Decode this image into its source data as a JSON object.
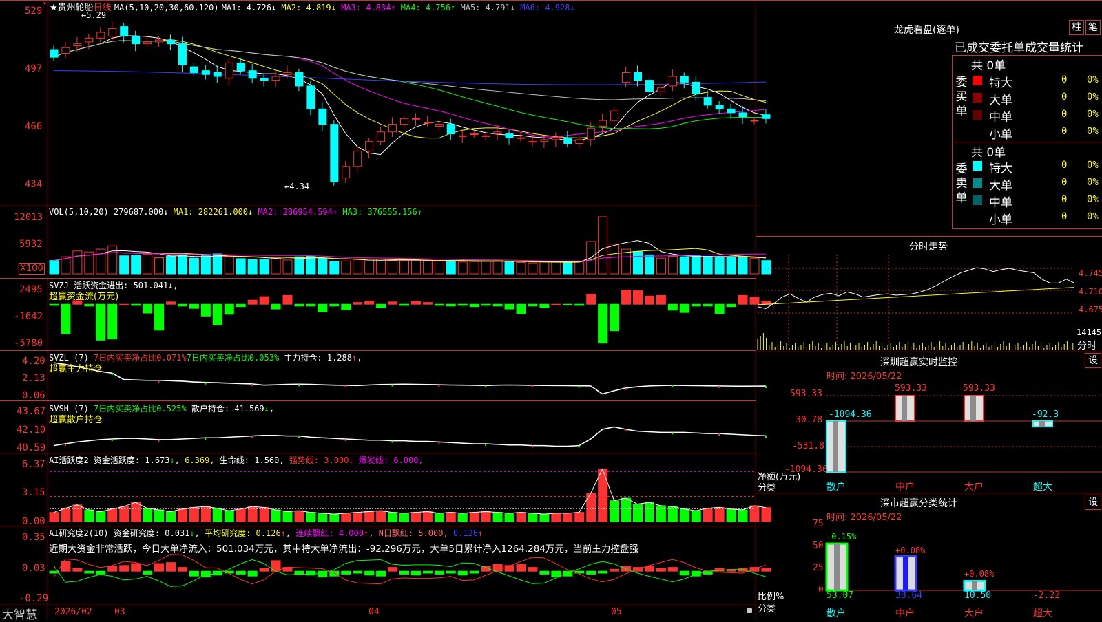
{
  "header": {
    "star": "★",
    "stock_name": "贵州轮胎",
    "period": "日线",
    "ma_params": "MA(5,10,20,30,60,120)",
    "mas": [
      {
        "label": "MA1:",
        "value": "4.726",
        "arrow": "↓",
        "color": "#ffffff"
      },
      {
        "label": "MA2:",
        "value": "4.819",
        "arrow": "↓",
        "color": "#ffff00"
      },
      {
        "label": "MA3:",
        "value": "4.834",
        "arrow": "↑",
        "color": "#ff00ff"
      },
      {
        "label": "MA4:",
        "value": "4.756",
        "arrow": "↑",
        "color": "#00ff00"
      },
      {
        "label": "MA5:",
        "value": "4.791",
        "arrow": "↓",
        "color": "#c0c0c0"
      },
      {
        "label": "MA6:",
        "value": "4.928",
        "arrow": "↓",
        "color": "#3c3cff"
      }
    ],
    "price_ticks": [
      "529",
      "497",
      "466",
      "434"
    ],
    "high_label": "5.29",
    "low_label": "4.34"
  },
  "vol": {
    "header": "VOL(5,10,20)",
    "value": "279687.000",
    "value_arrow": "↓",
    "ma1": "MA1: 282261.000",
    "ma1_arrow": "↓",
    "ma2": "MA2: 286954.594",
    "ma2_arrow": "↑",
    "ma3": "MA3: 376555.156",
    "ma3_arrow": "↑",
    "ticks": [
      "12013",
      "5932"
    ],
    "unit": "X100"
  },
  "svzj": {
    "header": "SVZJ  活跃资金进出: 501.041",
    "header_arrow": "↓",
    "sub": "超赢资金流(万元)",
    "ticks": [
      "2495",
      "-1642",
      "-5780"
    ]
  },
  "svzl": {
    "header": "SVZL (7)",
    "t1": "7日内买卖净占比0.071%",
    "t2": "7日内买卖净占比0.053%",
    "t3": "主力持仓: 1.288",
    "t3_arrow": "↑",
    "sub": "超赢主力持仓",
    "ticks": [
      "4.20",
      "2.13",
      "0.06"
    ]
  },
  "svsh": {
    "header": "SVSH (7)",
    "t1": "7日内买卖净占比0.525%",
    "t2": "散户持仓: 41.569",
    "t2_arrow": "↓",
    "sub": "超赢散户持仓",
    "ticks": [
      "43.67",
      "42.10",
      "40.59"
    ]
  },
  "ai1": {
    "header": "AI活跃度2",
    "t1": "资金活跃度: 1.673",
    "t1_arrow": "↓",
    "t2": "6.369",
    "t3": "生命线: 1.560,",
    "t4": "强势线: 3.000,",
    "t5": "爆发线: 6.000,",
    "ticks": [
      "6.37",
      "3.15",
      "0.00"
    ]
  },
  "ai2": {
    "header": "AI研究度2(10)",
    "t1": "资金研究度: 0.031",
    "t1_arrow": "↓",
    "t2": "平均研究度: 0.126",
    "t2_arrow": "↑",
    "t3": "连续飘红: 4.000",
    "t3_arrow": "↑",
    "t4": "N日飘红: 5.000,",
    "t5": "0.126",
    "t5_arrow": "↑",
    "comment": "近期大资金非常活跃，今日大单净流入：501.034万元，其中特大单净流出：-92.296万元，大单5日累计净入1264.284万元，当前主力控盘强",
    "ticks": [
      "0.35",
      "0.03",
      "-0.29"
    ]
  },
  "footer": {
    "brand": "大智慧",
    "dates": [
      "2026/02",
      "03",
      "04",
      "05"
    ]
  },
  "right": {
    "lh_title": "龙虎看盘(逐单)",
    "btn_zhu": "柱",
    "btn_bi": "笔",
    "lh_sub": "已成交委托单成交量统计",
    "buy_label": "委买单",
    "sell_label": "委卖单",
    "buy_total": "共 0单",
    "sell_total": "共 0单",
    "buy_rows": [
      {
        "name": "特大",
        "n": "0",
        "pct": "0%",
        "color": "#ff0000"
      },
      {
        "name": "大单",
        "n": "0",
        "pct": "0%",
        "color": "#8c0000"
      },
      {
        "name": "中单",
        "n": "0",
        "pct": "0%",
        "color": "#640000"
      },
      {
        "name": "小单",
        "n": "0",
        "pct": "0%",
        "color": "#000000"
      }
    ],
    "sell_rows": [
      {
        "name": "特大",
        "n": "0",
        "pct": "0%",
        "color": "#00ffff"
      },
      {
        "name": "大单",
        "n": "0",
        "pct": "0%",
        "color": "#008c8c"
      },
      {
        "name": "中单",
        "n": "0",
        "pct": "0%",
        "color": "#006464"
      },
      {
        "name": "小单",
        "n": "0",
        "pct": "0%",
        "color": "#000000"
      }
    ],
    "fs_title": "分时走势",
    "fs_ticks": [
      "4.745",
      "4.710",
      "4.675"
    ],
    "fs_vol": "14145",
    "fs_unit": "分时",
    "sz_title": "深圳超赢实时监控",
    "sz_btn": "设",
    "sz_time": "时间: 2026/05/22",
    "sz_ticks": [
      "593.33",
      "30.78",
      "-531.8",
      "-1094.36"
    ],
    "sz_ylabel": "净额(万元)",
    "sz_xlabel": "分类",
    "sz_bar_labels": [
      "-1094.36",
      "593.33",
      "593.33",
      "-92.3"
    ],
    "cat": [
      "散户",
      "中户",
      "大户",
      "超大"
    ],
    "ss_title": "深市超赢分类统计",
    "ss_btn": "设",
    "ss_time": "时间: 2026/05/22",
    "ss_ticks": [
      "75",
      "50",
      "25",
      "0"
    ],
    "ss_ylabel": "比例%",
    "ss_xlabel": "分类",
    "ss_bar_labels": [
      "-0.15%",
      "+0.08%",
      "+0.08%"
    ],
    "ss_values": [
      "53.07",
      "38.64",
      "10.50",
      "-2.22"
    ]
  },
  "chart_data": [
    {
      "type": "candlestick",
      "title": "贵州轮胎 日线",
      "y_range": [
        4.34,
        5.29
      ],
      "close": [
        5.05,
        5.1,
        5.12,
        5.15,
        5.18,
        5.2,
        5.16,
        5.12,
        5.13,
        5.14,
        5.12,
        5.01,
        4.97,
        4.96,
        4.95,
        5.02,
        4.98,
        4.94,
        4.93,
        4.95,
        4.97,
        4.9,
        4.78,
        4.7,
        4.4,
        4.48,
        4.56,
        4.61,
        4.66,
        4.7,
        4.73,
        4.73,
        4.71,
        4.7,
        4.65,
        4.64,
        4.65,
        4.64,
        4.66,
        4.63,
        4.63,
        4.61,
        4.62,
        4.63,
        4.6,
        4.62,
        4.68,
        4.72,
        4.77,
        4.97,
        4.93,
        4.87,
        4.89,
        4.95,
        4.92,
        4.86,
        4.8,
        4.78,
        4.76,
        4.74,
        4.72,
        4.73
      ],
      "open": [
        5.09,
        5.07,
        5.11,
        5.13,
        5.15,
        5.16,
        5.21,
        5.16,
        5.12,
        5.13,
        5.14,
        5.12,
        5.0,
        4.98,
        4.97,
        4.94,
        5.02,
        4.98,
        4.94,
        4.93,
        4.96,
        4.97,
        4.9,
        4.78,
        4.7,
        4.42,
        4.48,
        4.56,
        4.61,
        4.66,
        4.7,
        4.73,
        4.71,
        4.69,
        4.7,
        4.64,
        4.65,
        4.64,
        4.65,
        4.65,
        4.63,
        4.61,
        4.61,
        4.62,
        4.63,
        4.6,
        4.62,
        4.69,
        4.72,
        4.92,
        4.97,
        4.93,
        4.87,
        4.9,
        4.95,
        4.92,
        4.84,
        4.8,
        4.78,
        4.76,
        4.72,
        4.75
      ]
    },
    {
      "type": "bar",
      "title": "VOL(5,10,20)",
      "values": [
        2800,
        3600,
        4800,
        4600,
        5200,
        5900,
        3800,
        3900,
        4100,
        3400,
        3700,
        3900,
        3300,
        3800,
        4200,
        3600,
        3200,
        3000,
        3100,
        3400,
        2900,
        3600,
        3700,
        3300,
        2600,
        2700,
        3000,
        2900,
        3100,
        2800,
        2700,
        2900,
        2800,
        2700,
        2600,
        2500,
        2600,
        2700,
        2800,
        2500,
        2400,
        2300,
        2500,
        2600,
        2400,
        2500,
        6800,
        12013,
        6300,
        5200,
        4700,
        4000,
        3300,
        3700,
        3600,
        3800,
        3700,
        3500,
        3600,
        3400,
        3300,
        2796
      ]
    },
    {
      "type": "bar",
      "title": "超赢资金流(万元)",
      "values": [
        -200,
        -5000,
        600,
        -300,
        -6100,
        -5900,
        0,
        -200,
        -1500,
        -4400,
        400,
        -300,
        -700,
        -2000,
        -3500,
        -1700,
        -400,
        700,
        1300,
        -800,
        1500,
        -300,
        -300,
        -1300,
        -300,
        -900,
        300,
        500,
        -600,
        400,
        -200,
        500,
        300,
        -200,
        -300,
        -200,
        -400,
        -200,
        -300,
        -800,
        -1600,
        -300,
        -600,
        0,
        -100,
        -200,
        1700,
        -6600,
        -4500,
        2400,
        2300,
        1400,
        1500,
        -1000,
        -1400,
        -300,
        -300,
        -1600,
        -400,
        1500,
        1200,
        501
      ]
    },
    {
      "type": "line",
      "title": "超赢主力持仓",
      "values": [
        4.2,
        4.0,
        3.7,
        3.4,
        3.1,
        2.9,
        2.1,
        2.05,
        2.0,
        2.0,
        1.95,
        1.9,
        1.8,
        1.75,
        1.7,
        1.65,
        1.6,
        1.55,
        1.4,
        1.45,
        1.5,
        1.52,
        1.5,
        1.45,
        1.4,
        1.38,
        1.35,
        1.42,
        1.48,
        1.5,
        1.52,
        1.5,
        1.48,
        1.45,
        1.42,
        1.4,
        1.38,
        1.35,
        1.4,
        1.42,
        1.4,
        1.38,
        1.36,
        1.35,
        1.34,
        1.32,
        1.3,
        0.3,
        0.7,
        1.05,
        1.2,
        1.3,
        1.35,
        1.38,
        1.36,
        1.34,
        1.32,
        1.3,
        1.28,
        1.26,
        1.28,
        1.288
      ]
    },
    {
      "type": "line",
      "title": "超赢散户持仓",
      "values": [
        40.75,
        40.9,
        41.05,
        41.15,
        41.25,
        41.3,
        41.35,
        41.35,
        41.3,
        41.25,
        41.25,
        41.3,
        41.35,
        41.4,
        41.4,
        41.45,
        41.5,
        41.55,
        41.6,
        41.6,
        41.55,
        41.55,
        41.45,
        41.4,
        41.35,
        41.3,
        41.25,
        41.2,
        41.2,
        41.15,
        41.15,
        41.1,
        41.1,
        41.05,
        41.0,
        40.95,
        40.9,
        40.9,
        40.85,
        40.8,
        40.8,
        40.75,
        40.75,
        40.7,
        40.7,
        40.75,
        41.3,
        42.1,
        42.3,
        42.1,
        41.95,
        41.9,
        41.85,
        41.85,
        41.85,
        41.8,
        41.75,
        41.75,
        41.7,
        41.65,
        41.6,
        41.569
      ]
    },
    {
      "type": "bar",
      "title": "AI活跃度2",
      "values": [
        1.1,
        1.6,
        2.0,
        1.4,
        1.2,
        1.5,
        1.8,
        2.3,
        1.6,
        1.4,
        1.2,
        1.5,
        1.7,
        1.8,
        1.6,
        1.3,
        1.5,
        1.8,
        1.7,
        1.4,
        1.2,
        1.3,
        1.1,
        1.0,
        0.9,
        1.0,
        1.1,
        1.2,
        1.3,
        1.1,
        1.0,
        1.1,
        1.2,
        1.0,
        1.1,
        1.0,
        1.1,
        1.2,
        1.1,
        1.0,
        1.1,
        1.0,
        0.9,
        1.0,
        1.0,
        1.1,
        3.4,
        6.3,
        2.5,
        2.8,
        2.1,
        2.3,
        1.9,
        1.8,
        1.5,
        1.3,
        1.6,
        1.7,
        1.5,
        1.4,
        1.9,
        1.673
      ]
    },
    {
      "type": "bar",
      "title": "AI研究度2(10)",
      "values": [
        -0.02,
        0.1,
        0.03,
        -0.02,
        -0.03,
        0.05,
        0.06,
        0.08,
        -0.03,
        0.08,
        0.09,
        0.04,
        -0.05,
        -0.06,
        -0.04,
        -0.02,
        -0.03,
        -0.05,
        0.03,
        0.11,
        0.04,
        -0.03,
        -0.04,
        -0.06,
        -0.05,
        -0.03,
        -0.02,
        -0.04,
        -0.05,
        0.04,
        -0.03,
        -0.04,
        -0.02,
        -0.03,
        -0.02,
        -0.04,
        -0.02,
        0.05,
        0.07,
        0.06,
        0.07,
        0.04,
        -0.03,
        -0.06,
        -0.05,
        -0.02,
        -0.03,
        -0.02,
        0.02,
        0.05,
        0.04,
        0.05,
        0.03,
        0.04,
        -0.04,
        -0.05,
        -0.03,
        0.03,
        0.02,
        0.03,
        0.04,
        0.031
      ]
    },
    {
      "type": "bar",
      "title": "深圳超赢实时监控",
      "categories": [
        "散户",
        "中户",
        "大户",
        "超大"
      ],
      "values": [
        -1094.36,
        593.33,
        593.33,
        -92.3
      ]
    },
    {
      "type": "bar",
      "title": "深市超赢分类统计",
      "categories": [
        "散户",
        "中户",
        "大户",
        "超大"
      ],
      "values": [
        53.07,
        38.64,
        10.5,
        -2.22
      ]
    },
    {
      "type": "line",
      "title": "分时走势",
      "y_range": [
        4.675,
        4.745
      ],
      "values": [
        4.685,
        4.682,
        4.69,
        4.7,
        4.705,
        4.698,
        4.692,
        4.7,
        4.704,
        4.706,
        4.702,
        4.708,
        4.705,
        4.7,
        4.702,
        4.704,
        4.705,
        4.703,
        4.704,
        4.705,
        4.708,
        4.712,
        4.718,
        4.725,
        4.732,
        4.738,
        4.742,
        4.746,
        4.744,
        4.74,
        4.743,
        4.745,
        4.742,
        4.74,
        4.738,
        4.728,
        4.722,
        4.722,
        4.728,
        4.722
      ]
    }
  ]
}
